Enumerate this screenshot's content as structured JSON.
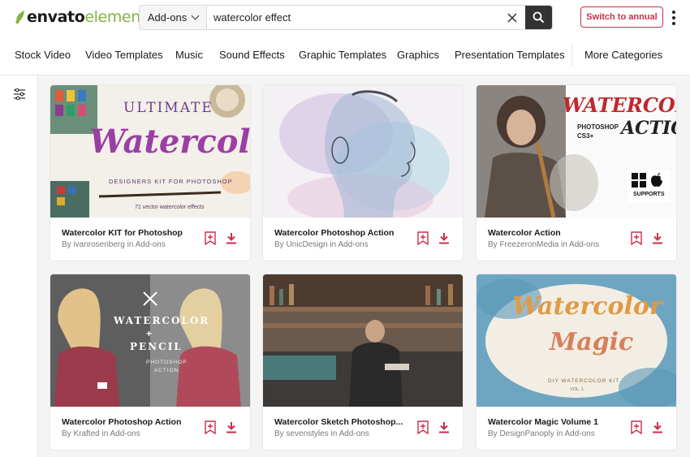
{
  "header": {
    "logo_part1": "envato",
    "logo_part2": "elements",
    "search_category": "Add-ons",
    "search_value": "watercolor effect",
    "switch_button": "Switch to annual"
  },
  "nav": {
    "items": [
      "Stock Video",
      "Video Templates",
      "Music",
      "Sound Effects",
      "Graphic Templates",
      "Graphics",
      "Presentation Templates"
    ],
    "more": "More Categories"
  },
  "cards": [
    {
      "title": "Watercolor KIT for Photoshop",
      "by": "By ivanrosenberg in Add-ons",
      "art": [
        "ULTIMATE",
        "Watercolor",
        "DESIGNERS KIT FOR PHOTOSHOP",
        "71 vector watercolor effects"
      ]
    },
    {
      "title": "Watercolor Photoshop Action",
      "by": "By UnicDesign in Add-ons",
      "art": []
    },
    {
      "title": "Watercolor Action",
      "by": "By FreezeronMedia in Add-ons",
      "art": [
        "WATERCOLOR",
        "PHOTOSHOP CS3+",
        "ACTION",
        "SUPPORTS"
      ]
    },
    {
      "title": "Watercolor Photoshop Action",
      "by": "By Krafted in Add-ons",
      "art": [
        "WATERCOLOR",
        "+",
        "PENCIL",
        "PHOTOSHOP ACTION"
      ]
    },
    {
      "title": "Watercolor Sketch Photoshop...",
      "by": "By sevenstyles in Add-ons",
      "art": []
    },
    {
      "title": "Watercolor Magic Volume 1",
      "by": "By DesignPanoply in Add-ons",
      "art": [
        "Watercolor",
        "Magic",
        "DIY WATERCOLOR KIT",
        "VOL. 1"
      ]
    }
  ],
  "colors": {
    "accent": "#cc2e4a",
    "logo_green": "#82b541",
    "search_button": "#333333"
  }
}
